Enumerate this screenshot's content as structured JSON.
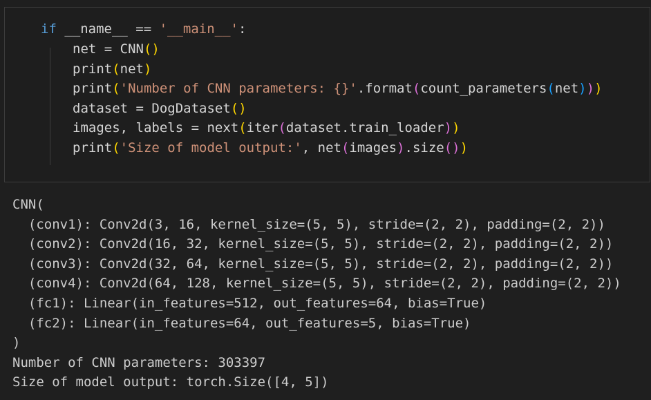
{
  "code_cell": {
    "lines": [
      {
        "tokens": [
          {
            "t": "if",
            "c": "kw"
          },
          {
            "t": " __name__ == ",
            "c": "txt"
          },
          {
            "t": "'__main__'",
            "c": "str"
          },
          {
            "t": ":",
            "c": "txt"
          }
        ]
      },
      {
        "tokens": [
          {
            "t": "net = CNN",
            "c": "txt"
          },
          {
            "t": "()",
            "c": "p1"
          }
        ]
      },
      {
        "tokens": [
          {
            "t": "print",
            "c": "txt"
          },
          {
            "t": "(",
            "c": "p1"
          },
          {
            "t": "net",
            "c": "txt"
          },
          {
            "t": ")",
            "c": "p1"
          }
        ]
      },
      {
        "tokens": [
          {
            "t": "print",
            "c": "txt"
          },
          {
            "t": "(",
            "c": "p1"
          },
          {
            "t": "'Number of CNN parameters: {}'",
            "c": "str"
          },
          {
            "t": ".format",
            "c": "txt"
          },
          {
            "t": "(",
            "c": "p2"
          },
          {
            "t": "count_parameters",
            "c": "txt"
          },
          {
            "t": "(",
            "c": "p3"
          },
          {
            "t": "net",
            "c": "txt"
          },
          {
            "t": ")",
            "c": "p3"
          },
          {
            "t": ")",
            "c": "p2"
          },
          {
            "t": ")",
            "c": "p1"
          }
        ]
      },
      {
        "tokens": [
          {
            "t": "dataset = DogDataset",
            "c": "txt"
          },
          {
            "t": "()",
            "c": "p1"
          }
        ]
      },
      {
        "tokens": [
          {
            "t": "images, labels = next",
            "c": "txt"
          },
          {
            "t": "(",
            "c": "p1"
          },
          {
            "t": "iter",
            "c": "txt"
          },
          {
            "t": "(",
            "c": "p2"
          },
          {
            "t": "dataset.train_loader",
            "c": "txt"
          },
          {
            "t": ")",
            "c": "p2"
          },
          {
            "t": ")",
            "c": "p1"
          }
        ]
      },
      {
        "tokens": [
          {
            "t": "print",
            "c": "txt"
          },
          {
            "t": "(",
            "c": "p1"
          },
          {
            "t": "'Size of model output:'",
            "c": "str"
          },
          {
            "t": ", net",
            "c": "txt"
          },
          {
            "t": "(",
            "c": "p2"
          },
          {
            "t": "images",
            "c": "txt"
          },
          {
            "t": ")",
            "c": "p2"
          },
          {
            "t": ".size",
            "c": "txt"
          },
          {
            "t": "()",
            "c": "p2"
          },
          {
            "t": ")",
            "c": "p1"
          }
        ]
      }
    ]
  },
  "output": {
    "lines": [
      "CNN(",
      "  (conv1): Conv2d(3, 16, kernel_size=(5, 5), stride=(2, 2), padding=(2, 2))",
      "  (conv2): Conv2d(16, 32, kernel_size=(5, 5), stride=(2, 2), padding=(2, 2))",
      "  (conv3): Conv2d(32, 64, kernel_size=(5, 5), stride=(2, 2), padding=(2, 2))",
      "  (conv4): Conv2d(64, 128, kernel_size=(5, 5), stride=(2, 2), padding=(2, 2))",
      "  (fc1): Linear(in_features=512, out_features=64, bias=True)",
      "  (fc2): Linear(in_features=64, out_features=5, bias=True)",
      ")",
      "Number of CNN parameters: 303397",
      "Size of model output: torch.Size([4, 5])"
    ]
  },
  "colors": {
    "background": "#1f1f1f",
    "cell_background": "#1e1e1e",
    "keyword": "#569cd6",
    "string": "#ce9178",
    "bracket_1": "#ffd700",
    "bracket_2": "#da70d6",
    "bracket_3": "#179fff",
    "text": "#d4d4d4"
  }
}
